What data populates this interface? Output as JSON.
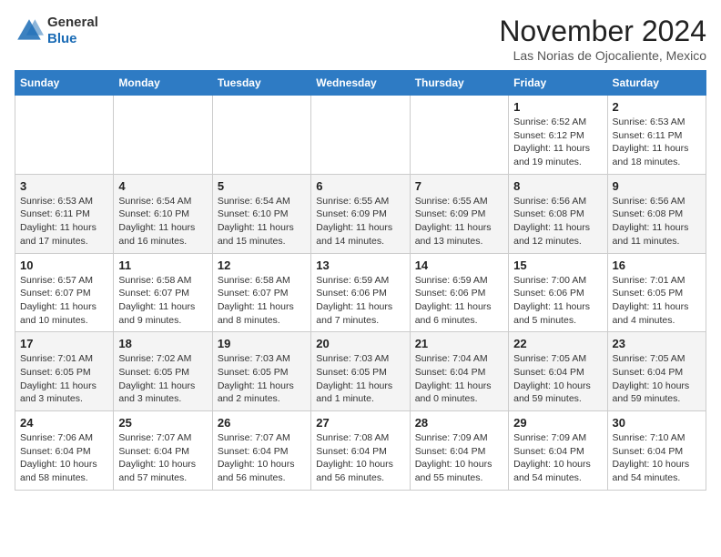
{
  "header": {
    "logo_line1": "General",
    "logo_line2": "Blue",
    "month": "November 2024",
    "location": "Las Norias de Ojocaliente, Mexico"
  },
  "weekdays": [
    "Sunday",
    "Monday",
    "Tuesday",
    "Wednesday",
    "Thursday",
    "Friday",
    "Saturday"
  ],
  "weeks": [
    [
      {
        "day": "",
        "info": ""
      },
      {
        "day": "",
        "info": ""
      },
      {
        "day": "",
        "info": ""
      },
      {
        "day": "",
        "info": ""
      },
      {
        "day": "",
        "info": ""
      },
      {
        "day": "1",
        "info": "Sunrise: 6:52 AM\nSunset: 6:12 PM\nDaylight: 11 hours and 19 minutes."
      },
      {
        "day": "2",
        "info": "Sunrise: 6:53 AM\nSunset: 6:11 PM\nDaylight: 11 hours and 18 minutes."
      }
    ],
    [
      {
        "day": "3",
        "info": "Sunrise: 6:53 AM\nSunset: 6:11 PM\nDaylight: 11 hours and 17 minutes."
      },
      {
        "day": "4",
        "info": "Sunrise: 6:54 AM\nSunset: 6:10 PM\nDaylight: 11 hours and 16 minutes."
      },
      {
        "day": "5",
        "info": "Sunrise: 6:54 AM\nSunset: 6:10 PM\nDaylight: 11 hours and 15 minutes."
      },
      {
        "day": "6",
        "info": "Sunrise: 6:55 AM\nSunset: 6:09 PM\nDaylight: 11 hours and 14 minutes."
      },
      {
        "day": "7",
        "info": "Sunrise: 6:55 AM\nSunset: 6:09 PM\nDaylight: 11 hours and 13 minutes."
      },
      {
        "day": "8",
        "info": "Sunrise: 6:56 AM\nSunset: 6:08 PM\nDaylight: 11 hours and 12 minutes."
      },
      {
        "day": "9",
        "info": "Sunrise: 6:56 AM\nSunset: 6:08 PM\nDaylight: 11 hours and 11 minutes."
      }
    ],
    [
      {
        "day": "10",
        "info": "Sunrise: 6:57 AM\nSunset: 6:07 PM\nDaylight: 11 hours and 10 minutes."
      },
      {
        "day": "11",
        "info": "Sunrise: 6:58 AM\nSunset: 6:07 PM\nDaylight: 11 hours and 9 minutes."
      },
      {
        "day": "12",
        "info": "Sunrise: 6:58 AM\nSunset: 6:07 PM\nDaylight: 11 hours and 8 minutes."
      },
      {
        "day": "13",
        "info": "Sunrise: 6:59 AM\nSunset: 6:06 PM\nDaylight: 11 hours and 7 minutes."
      },
      {
        "day": "14",
        "info": "Sunrise: 6:59 AM\nSunset: 6:06 PM\nDaylight: 11 hours and 6 minutes."
      },
      {
        "day": "15",
        "info": "Sunrise: 7:00 AM\nSunset: 6:06 PM\nDaylight: 11 hours and 5 minutes."
      },
      {
        "day": "16",
        "info": "Sunrise: 7:01 AM\nSunset: 6:05 PM\nDaylight: 11 hours and 4 minutes."
      }
    ],
    [
      {
        "day": "17",
        "info": "Sunrise: 7:01 AM\nSunset: 6:05 PM\nDaylight: 11 hours and 3 minutes."
      },
      {
        "day": "18",
        "info": "Sunrise: 7:02 AM\nSunset: 6:05 PM\nDaylight: 11 hours and 3 minutes."
      },
      {
        "day": "19",
        "info": "Sunrise: 7:03 AM\nSunset: 6:05 PM\nDaylight: 11 hours and 2 minutes."
      },
      {
        "day": "20",
        "info": "Sunrise: 7:03 AM\nSunset: 6:05 PM\nDaylight: 11 hours and 1 minute."
      },
      {
        "day": "21",
        "info": "Sunrise: 7:04 AM\nSunset: 6:04 PM\nDaylight: 11 hours and 0 minutes."
      },
      {
        "day": "22",
        "info": "Sunrise: 7:05 AM\nSunset: 6:04 PM\nDaylight: 10 hours and 59 minutes."
      },
      {
        "day": "23",
        "info": "Sunrise: 7:05 AM\nSunset: 6:04 PM\nDaylight: 10 hours and 59 minutes."
      }
    ],
    [
      {
        "day": "24",
        "info": "Sunrise: 7:06 AM\nSunset: 6:04 PM\nDaylight: 10 hours and 58 minutes."
      },
      {
        "day": "25",
        "info": "Sunrise: 7:07 AM\nSunset: 6:04 PM\nDaylight: 10 hours and 57 minutes."
      },
      {
        "day": "26",
        "info": "Sunrise: 7:07 AM\nSunset: 6:04 PM\nDaylight: 10 hours and 56 minutes."
      },
      {
        "day": "27",
        "info": "Sunrise: 7:08 AM\nSunset: 6:04 PM\nDaylight: 10 hours and 56 minutes."
      },
      {
        "day": "28",
        "info": "Sunrise: 7:09 AM\nSunset: 6:04 PM\nDaylight: 10 hours and 55 minutes."
      },
      {
        "day": "29",
        "info": "Sunrise: 7:09 AM\nSunset: 6:04 PM\nDaylight: 10 hours and 54 minutes."
      },
      {
        "day": "30",
        "info": "Sunrise: 7:10 AM\nSunset: 6:04 PM\nDaylight: 10 hours and 54 minutes."
      }
    ]
  ]
}
